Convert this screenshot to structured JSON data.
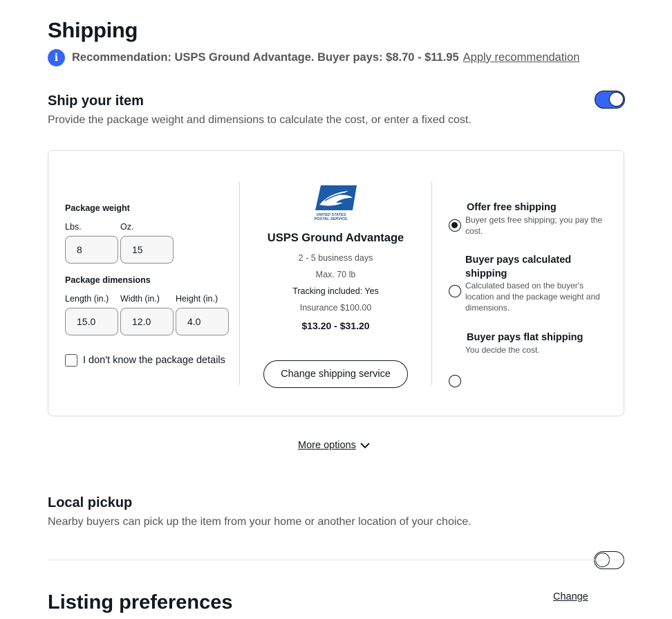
{
  "page": {
    "title": "Shipping"
  },
  "recommendation": {
    "text": "Recommendation: USPS Ground Advantage. Buyer pays: $8.70 - $11.95",
    "link": "Apply recommendation"
  },
  "ship_item": {
    "title": "Ship your item",
    "subtitle": "Provide the package weight and dimensions to calculate the cost, or enter a fixed cost.",
    "toggle_on": true
  },
  "package": {
    "weight_label": "Package weight",
    "lbs_label": "Lbs.",
    "oz_label": "Oz.",
    "lbs_value": "8",
    "oz_value": "15",
    "dimensions_label": "Package dimensions",
    "length_label": "Length (in.)",
    "width_label": "Width (in.)",
    "height_label": "Height (in.)",
    "length_value": "15.0",
    "width_value": "12.0",
    "height_value": "4.0",
    "unknown_label": "I don't know the package details"
  },
  "service": {
    "logo_text_1": "UNITED STATES",
    "logo_text_2": "POSTAL SERVICE.",
    "name": "USPS Ground Advantage",
    "days": "2 - 5 business days",
    "max": "Max. 70 lb",
    "tracking": "Tracking included: Yes",
    "insurance": "Insurance $100.00",
    "price": "$13.20 - $31.20",
    "change_button": "Change shipping service"
  },
  "options": [
    {
      "title": "Offer free shipping",
      "desc": "Buyer gets free shipping; you pay the cost.",
      "selected": true
    },
    {
      "title": "Buyer pays calculated shipping",
      "desc": "Calculated based on the buyer's location and the package weight and dimensions.",
      "selected": false
    },
    {
      "title": "Buyer pays flat shipping",
      "desc": "You decide the cost.",
      "selected": false
    }
  ],
  "more_options": "More options",
  "local_pickup": {
    "title": "Local pickup",
    "subtitle": "Nearby buyers can pick up the item from your home or another location of your choice.",
    "toggle_on": false
  },
  "listing_preferences": {
    "title": "Listing preferences",
    "change_link": "Change"
  },
  "colors": {
    "accent": "#3665f3",
    "usps_blue": "#1c5ba8",
    "text": "#111820",
    "muted": "#555555"
  },
  "icons": {
    "info": "info-icon",
    "chevron": "chevron-down-icon",
    "logo": "usps-eagle-logo"
  }
}
